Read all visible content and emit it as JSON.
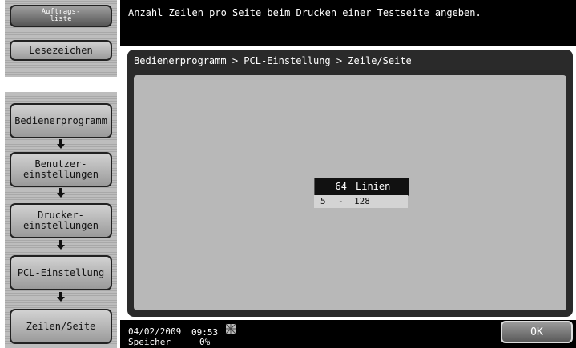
{
  "sidebar": {
    "job_list_label": "Auftrags-\nliste",
    "bookmark_label": "Lesezeichen",
    "breadcrumb_buttons": [
      {
        "label": "Bedienerprogramm"
      },
      {
        "label": "Benutzer-\neinstellungen"
      },
      {
        "label": "Drucker-\neinstellungen"
      },
      {
        "label": "PCL-Einstellung"
      },
      {
        "label": "Zeilen/Seite"
      }
    ]
  },
  "header": {
    "message": "Anzahl Zeilen pro Seite beim Drucken einer Testseite angeben."
  },
  "panel": {
    "path": "Bedienerprogramm > PCL-Einstellung > Zeile/Seite",
    "value": "64",
    "unit": "Linien",
    "range_min": "5",
    "range_sep": "-",
    "range_max": "128"
  },
  "status": {
    "date": "04/02/2009",
    "time": "09:53",
    "memory_label": "Speicher",
    "memory_value": "0%"
  },
  "ok_label": "OK",
  "colors": {
    "panel_bg": "#2a2a2a",
    "inner_bg": "#b8b8b8",
    "status_bg": "#000000"
  }
}
